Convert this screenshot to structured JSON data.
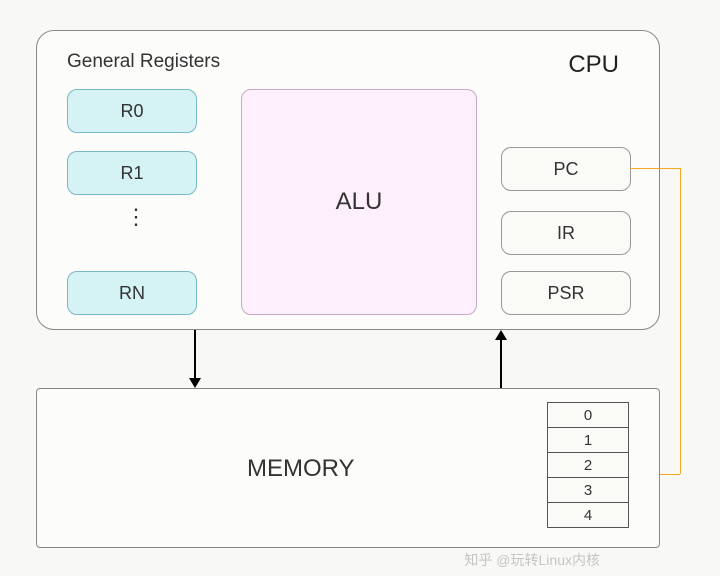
{
  "cpu": {
    "title": "General Registers",
    "label": "CPU",
    "registers": [
      "R0",
      "R1",
      "RN"
    ],
    "alu_label": "ALU",
    "special_registers": {
      "pc": "PC",
      "ir": "IR",
      "psr": "PSR"
    },
    "ellipsis": "⋮"
  },
  "memory": {
    "label": "MEMORY",
    "cells": [
      "0",
      "1",
      "2",
      "3",
      "4"
    ]
  },
  "watermark": "知乎 @玩转Linux内核"
}
